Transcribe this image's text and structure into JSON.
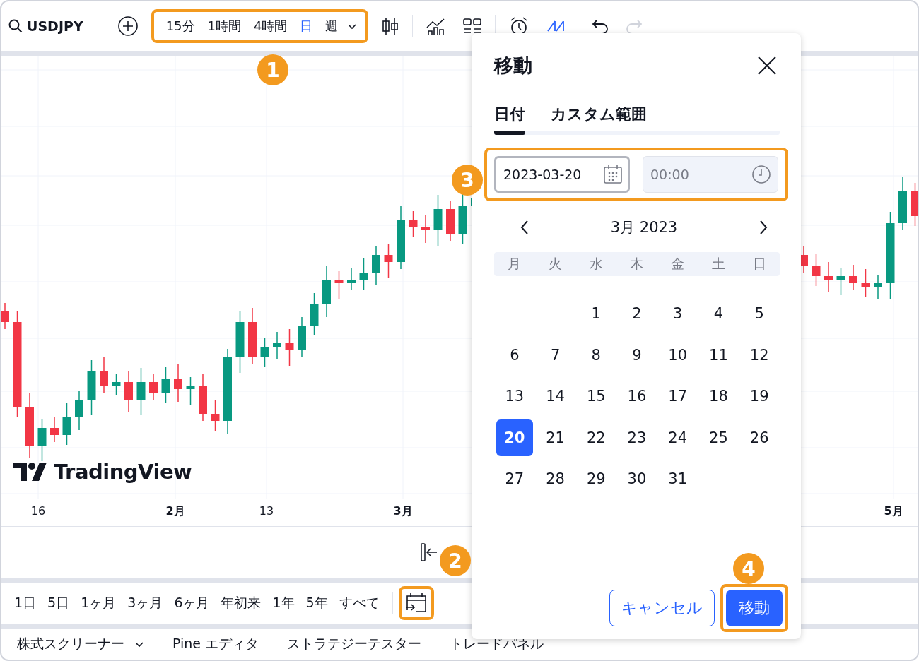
{
  "toolbar": {
    "symbol": "USDJPY",
    "intervals": [
      {
        "label": "15分",
        "selected": false
      },
      {
        "label": "1時間",
        "selected": false
      },
      {
        "label": "4時間",
        "selected": false
      },
      {
        "label": "日",
        "selected": true
      },
      {
        "label": "週",
        "selected": false
      }
    ],
    "callout": "1",
    "redo_disabled": true
  },
  "chart": {
    "logo": "TradingView",
    "axis_labels": [
      {
        "label": "16",
        "kind": "day"
      },
      {
        "label": "2月",
        "kind": "month"
      },
      {
        "label": "13",
        "kind": "day"
      },
      {
        "label": "3月",
        "kind": "month"
      },
      {
        "label": "5月",
        "kind": "month"
      }
    ]
  },
  "range_bar": {
    "ranges": [
      "1日",
      "5日",
      "1ヶ月",
      "3ヶ月",
      "6ヶ月",
      "年初来",
      "1年",
      "5年",
      "すべて"
    ],
    "callout": "2"
  },
  "bottom_tabs": [
    {
      "label": "株式スクリーナー",
      "dropdown": true
    },
    {
      "label": "Pine エディタ",
      "dropdown": false
    },
    {
      "label": "ストラテジーテスター",
      "dropdown": false
    },
    {
      "label": "トレードパネル",
      "dropdown": false
    }
  ],
  "dialog": {
    "title": "移動",
    "tabs": [
      {
        "label": "日付",
        "selected": true
      },
      {
        "label": "カスタム範囲",
        "selected": false
      }
    ],
    "date_field": {
      "value": "2023-03-20"
    },
    "time_field": {
      "value": "00:00",
      "disabled": true
    },
    "fields_callout": "3",
    "month": "3月 2023",
    "weekdays": [
      "月",
      "火",
      "水",
      "木",
      "金",
      "土",
      "日"
    ],
    "weeks": [
      [
        {
          "day": "1",
          "selected": false
        },
        {
          "day": "2",
          "selected": false
        },
        {
          "day": "3",
          "selected": false
        },
        {
          "day": "4",
          "selected": false
        },
        {
          "day": "5",
          "selected": false
        }
      ],
      [
        {
          "day": "6",
          "selected": false
        },
        {
          "day": "7",
          "selected": false
        },
        {
          "day": "8",
          "selected": false
        },
        {
          "day": "9",
          "selected": false
        },
        {
          "day": "10",
          "selected": false
        },
        {
          "day": "11",
          "selected": false
        },
        {
          "day": "12",
          "selected": false
        }
      ],
      [
        {
          "day": "13",
          "selected": false
        },
        {
          "day": "14",
          "selected": false
        },
        {
          "day": "15",
          "selected": false
        },
        {
          "day": "16",
          "selected": false
        },
        {
          "day": "17",
          "selected": false
        },
        {
          "day": "18",
          "selected": false
        },
        {
          "day": "19",
          "selected": false
        }
      ],
      [
        {
          "day": "20",
          "selected": true
        },
        {
          "day": "21",
          "selected": false
        },
        {
          "day": "22",
          "selected": false
        },
        {
          "day": "23",
          "selected": false
        },
        {
          "day": "24",
          "selected": false
        },
        {
          "day": "25",
          "selected": false
        },
        {
          "day": "26",
          "selected": false
        }
      ],
      [
        {
          "day": "27",
          "selected": false
        },
        {
          "day": "28",
          "selected": false
        },
        {
          "day": "29",
          "selected": false
        },
        {
          "day": "30",
          "selected": false
        },
        {
          "day": "31",
          "selected": false
        }
      ]
    ],
    "cancel": "キャンセル",
    "submit": "移動",
    "buttons_callout": "4"
  }
}
